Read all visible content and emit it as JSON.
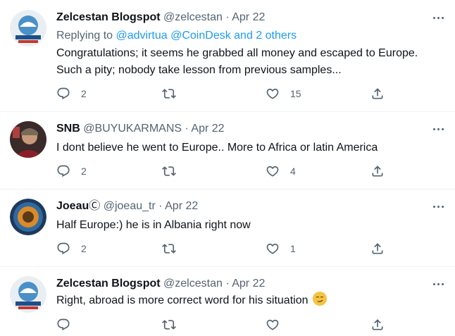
{
  "tweets": [
    {
      "name": "Zelcestan Blogspot",
      "handle": "@zelcestan",
      "sep": "·",
      "date": "Apr 22",
      "replying_prefix": "Replying to ",
      "replying_links": "@advirtua @CoinDesk and 2 others",
      "text_line1": "Congratulations; it seems he grabbed all money and escaped to Europe.",
      "text_line2": "Such a pity; nobody take lesson from previous samples...",
      "reply_count": "2",
      "retweet_count": "",
      "like_count": "15"
    },
    {
      "name": "SNB",
      "handle": "@BUYUKARMANS",
      "sep": "·",
      "date": "Apr 22",
      "text": "I dont believe he went to Europe.. More to Africa or  latin America",
      "reply_count": "2",
      "retweet_count": "",
      "like_count": "4"
    },
    {
      "name": "Joeau",
      "name_suffix": "Ⓒ",
      "handle": "@joeau_tr",
      "sep": "·",
      "date": "Apr 22",
      "text": "Half Europe:) he is in Albania right now",
      "reply_count": "2",
      "retweet_count": "",
      "like_count": "1"
    },
    {
      "name": "Zelcestan Blogspot",
      "handle": "@zelcestan",
      "sep": "·",
      "date": "Apr 22",
      "text": "Right, abroad is more correct word for his situation",
      "reply_count": "",
      "retweet_count": "",
      "like_count": ""
    }
  ],
  "icons": {
    "reply": "reply-icon",
    "retweet": "retweet-icon",
    "like": "heart-icon",
    "share": "share-icon",
    "more": "more-icon"
  },
  "colors": {
    "link": "#1d9bf0",
    "secondary": "#536471",
    "text": "#0f1419"
  }
}
